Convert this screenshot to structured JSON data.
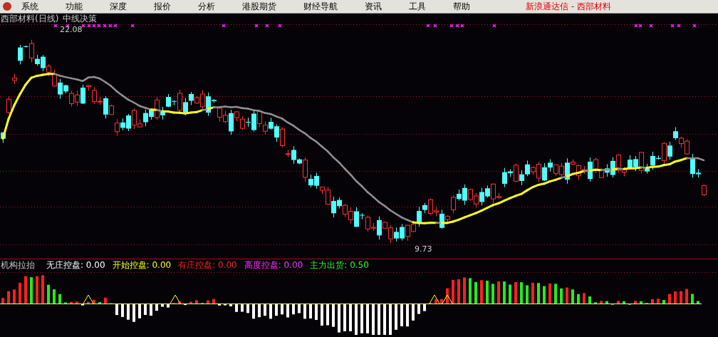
{
  "window": {
    "title": "新浪通达信 - 西部材料"
  },
  "menu": [
    "系统",
    "功能",
    "深度",
    "报价",
    "分析",
    "港股期货",
    "财经导航",
    "资讯",
    "工具",
    "帮助"
  ],
  "chart": {
    "title": "西部材料(日线)",
    "indicator": "中线决策",
    "high_label": "22.08",
    "low_label": "9.73"
  },
  "sub_chart": {
    "name": "机构拉抬",
    "items": [
      {
        "label": "无庄控盘:",
        "value": "0.00",
        "color": "#ffffff"
      },
      {
        "label": "开始控盘:",
        "value": "0.00",
        "color": "#ffff00"
      },
      {
        "label": "有庄控盘:",
        "value": "0.00",
        "color": "#ff2020"
      },
      {
        "label": "高度控盘:",
        "value": "0.00",
        "color": "#ff30ff"
      },
      {
        "label": "主力出货:",
        "value": "0.50",
        "color": "#20ff20"
      }
    ]
  }
}
